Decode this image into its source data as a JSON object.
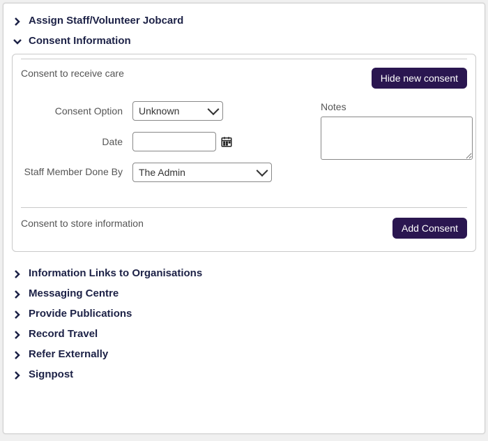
{
  "accordion": {
    "assign": "Assign Staff/Volunteer Jobcard",
    "consentInfo": "Consent Information",
    "links": "Information Links to Organisations",
    "messaging": "Messaging Centre",
    "publications": "Provide Publications",
    "travel": "Record Travel",
    "refer": "Refer Externally",
    "signpost": "Signpost"
  },
  "consent": {
    "receiveCareLabel": "Consent to receive care",
    "hideButton": "Hide new consent",
    "fields": {
      "optionLabel": "Consent Option",
      "optionValue": "Unknown",
      "dateLabel": "Date",
      "dateValue": "",
      "staffLabel": "Staff Member Done By",
      "staffValue": "The Admin",
      "notesLabel": "Notes",
      "notesValue": ""
    },
    "storeInfoLabel": "Consent to store information",
    "addButton": "Add Consent"
  }
}
